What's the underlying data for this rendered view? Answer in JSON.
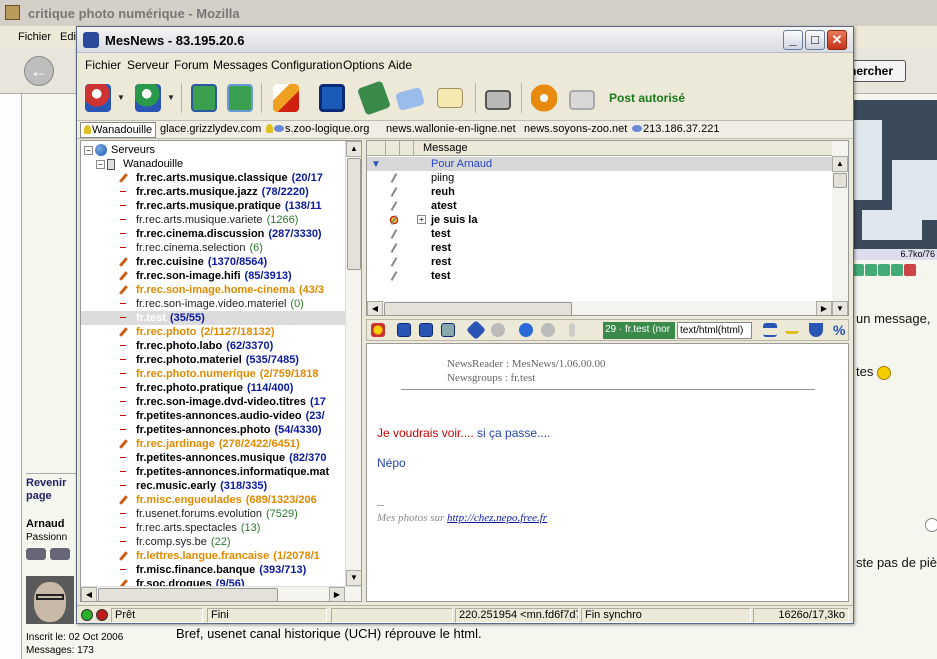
{
  "mozilla": {
    "title": "critique photo numérique - Mozilla",
    "menu": [
      "Fichier",
      "Edi"
    ],
    "search_label": "hercher",
    "photo_caption": "6.7ko/76",
    "text_right1": "un message,",
    "text_right2": "tes",
    "text_right3": "ste pas de piè",
    "back_link": "Revenir page",
    "username": "Arnaud",
    "usertitle": "Passionn",
    "inscrit": "Inscrit le: 02 Oct 2006",
    "messages": "Messages: 173",
    "bottom_text": "Bref, usenet canal historique (UCH) réprouve le html."
  },
  "mesnews": {
    "title": "MesNews - 83.195.20.6",
    "menu": [
      "Fichier",
      "Serveur",
      "Forum",
      "Messages",
      "Configuration",
      "Options",
      "Aide"
    ],
    "toolbar_status": "Post autorisé",
    "server_tabs": [
      "Wanadouille",
      "glace.grizzlydev.com",
      "s.zoo-logique.org",
      "news.wallonie-en-ligne.net",
      "news.soyons-zoo.net",
      "213.186.37.221"
    ],
    "tree_root": "Serveurs",
    "tree_server": "Wanadouille",
    "groups": [
      {
        "name": "fr.rec.arts.musique.classique",
        "count": "(20/17",
        "style": "bold",
        "icon": "pen"
      },
      {
        "name": "fr.rec.arts.musique.jazz",
        "count": "(78/2220)",
        "style": "bold",
        "icon": "dash"
      },
      {
        "name": "fr.rec.arts.musique.pratique",
        "count": "(138/11",
        "style": "bold",
        "icon": "dash"
      },
      {
        "name": "fr.rec.arts.musique.variete",
        "count": "(1266)",
        "style": "plain",
        "icon": "dash"
      },
      {
        "name": "fr.rec.cinema.discussion",
        "count": "(287/3330)",
        "style": "bold",
        "icon": "dash"
      },
      {
        "name": "fr.rec.cinema.selection",
        "count": "(6)",
        "style": "plain",
        "icon": "dash"
      },
      {
        "name": "fr.rec.cuisine",
        "count": "(1370/8564)",
        "style": "bold",
        "icon": "pen"
      },
      {
        "name": "fr.rec.son-image.hifi",
        "count": "(85/3913)",
        "style": "bold",
        "icon": "pen"
      },
      {
        "name": "fr.rec.son-image.home-cinema",
        "count": "(43/3",
        "style": "orange",
        "icon": "pen"
      },
      {
        "name": "fr.rec.son-image.video.materiel",
        "count": "(0)",
        "style": "plain",
        "icon": "dash"
      },
      {
        "name": "fr.test",
        "count": "(35/55)",
        "style": "sel",
        "icon": "dash"
      },
      {
        "name": "fr.rec.photo",
        "count": "(2/1127/18132)",
        "style": "orange",
        "icon": "pen"
      },
      {
        "name": "fr.rec.photo.labo",
        "count": "(62/3370)",
        "style": "bold",
        "icon": "dash"
      },
      {
        "name": "fr.rec.photo.materiel",
        "count": "(535/7485)",
        "style": "bold",
        "icon": "dash"
      },
      {
        "name": "fr.rec.photo.numerique",
        "count": "(2/759/1818",
        "style": "orange",
        "icon": "dash"
      },
      {
        "name": "fr.rec.photo.pratique",
        "count": "(114/400)",
        "style": "bold",
        "icon": "dash"
      },
      {
        "name": "fr.rec.son-image.dvd-video.titres",
        "count": "(17",
        "style": "bold",
        "icon": "dash"
      },
      {
        "name": "fr.petites-annonces.audio-video",
        "count": "(23/",
        "style": "bold",
        "icon": "dash"
      },
      {
        "name": "fr.petites-annonces.photo",
        "count": "(54/4330)",
        "style": "bold",
        "icon": "dash"
      },
      {
        "name": "fr.rec.jardinage",
        "count": "(278/2422/6451)",
        "style": "orange",
        "icon": "pen"
      },
      {
        "name": "fr.petites-annonces.musique",
        "count": "(82/370",
        "style": "bold",
        "icon": "dash"
      },
      {
        "name": "fr.petites-annonces.informatique.mat",
        "count": "",
        "style": "bold",
        "icon": "dash"
      },
      {
        "name": "rec.music.early",
        "count": "(318/335)",
        "style": "bold",
        "icon": "dash"
      },
      {
        "name": "fr.misc.engueulades",
        "count": "(689/1323/206",
        "style": "orange",
        "icon": "pen"
      },
      {
        "name": "fr.usenet.forums.evolution",
        "count": "(7529)",
        "style": "plain",
        "icon": "dash"
      },
      {
        "name": "fr.rec.arts.spectacles",
        "count": "(13)",
        "style": "plain",
        "icon": "dash"
      },
      {
        "name": "fr.comp.sys.be",
        "count": "(22)",
        "style": "plain",
        "icon": "dash"
      },
      {
        "name": "fr.lettres.langue.francaise",
        "count": "(1/2078/1",
        "style": "orange",
        "icon": "pen"
      },
      {
        "name": "fr.misc.finance.banque",
        "count": "(393/713)",
        "style": "bold",
        "icon": "dash"
      },
      {
        "name": "fr.soc.drogues",
        "count": "(9/56)",
        "style": "bold",
        "icon": "pen"
      }
    ],
    "message_header": "Message",
    "messages": [
      {
        "subject": "Pour Arnaud",
        "style": "link",
        "selected": true
      },
      {
        "subject": "piing",
        "style": "normal"
      },
      {
        "subject": "reuh",
        "style": "bold"
      },
      {
        "subject": "atest",
        "style": "bold"
      },
      {
        "subject": "je suis la",
        "style": "bold",
        "expand": "+"
      },
      {
        "subject": "test",
        "style": "bold"
      },
      {
        "subject": "rest",
        "style": "bold"
      },
      {
        "subject": "rest",
        "style": "bold"
      },
      {
        "subject": "test",
        "style": "bold"
      }
    ],
    "reader_toolbar": {
      "count": "29 · fr.test (nor",
      "format": "text/html(html)",
      "percent": "%"
    },
    "reader": {
      "header_newsreader": "NewsReader : MesNews/1.06.00.00",
      "header_newsgroups": "Newsgroups : fr.test",
      "body_red": "Je voudrais voir....",
      "body_blue": " si ça passe....",
      "body_name": "Népo",
      "sig_dash": "--",
      "sig_text": "Mes photos sur ",
      "sig_link": "http://chez.nepo.free.fr"
    },
    "status": {
      "ready": "Prêt",
      "done": "Fini",
      "msgid": "220.251954 <mn.fd6f7d7",
      "sync": "Fin synchro",
      "size": "1626o/17,3ko"
    },
    "colors": {
      "accent_green": "#3a8a4a",
      "orange_group": "#e08a00",
      "count_blue": "#0a1aa0"
    }
  }
}
